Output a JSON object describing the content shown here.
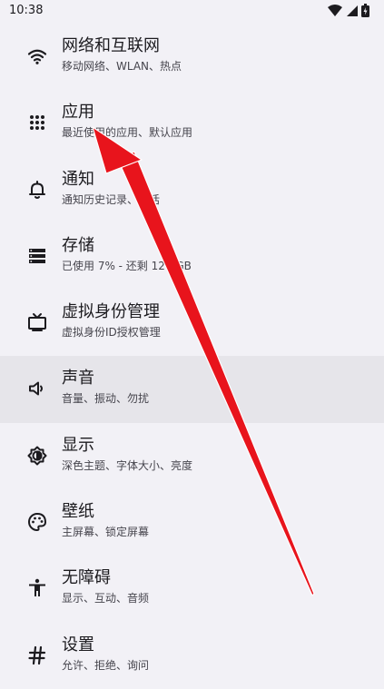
{
  "status_bar": {
    "time": "10:38",
    "icons": [
      "wifi-icon",
      "signal-icon",
      "battery-icon"
    ]
  },
  "settings": {
    "items": [
      {
        "title": "网络和互联网",
        "subtitle": "移动网络、WLAN、热点",
        "icon": "wifi-icon"
      },
      {
        "title": "应用",
        "subtitle": "最近使用的应用、默认应用",
        "icon": "apps-grid-icon"
      },
      {
        "title": "通知",
        "subtitle": "通知历史记录、对话",
        "icon": "bell-icon"
      },
      {
        "title": "存储",
        "subtitle": "已使用 7% - 还剩 127 GB",
        "icon": "storage-icon"
      },
      {
        "title": "虚拟身份管理",
        "subtitle": "虚拟身份ID授权管理",
        "icon": "tv-icon"
      },
      {
        "title": "声音",
        "subtitle": "音量、振动、勿扰",
        "icon": "speaker-icon"
      },
      {
        "title": "显示",
        "subtitle": "深色主题、字体大小、亮度",
        "icon": "brightness-icon"
      },
      {
        "title": "壁纸",
        "subtitle": "主屏幕、锁定屏幕",
        "icon": "palette-icon"
      },
      {
        "title": "无障碍",
        "subtitle": "显示、互动、音频",
        "icon": "accessibility-icon"
      },
      {
        "title": "设置",
        "subtitle": "允许、拒绝、询问",
        "icon": "hash-icon"
      }
    ]
  },
  "annotation": {
    "color": "#e8141c"
  }
}
